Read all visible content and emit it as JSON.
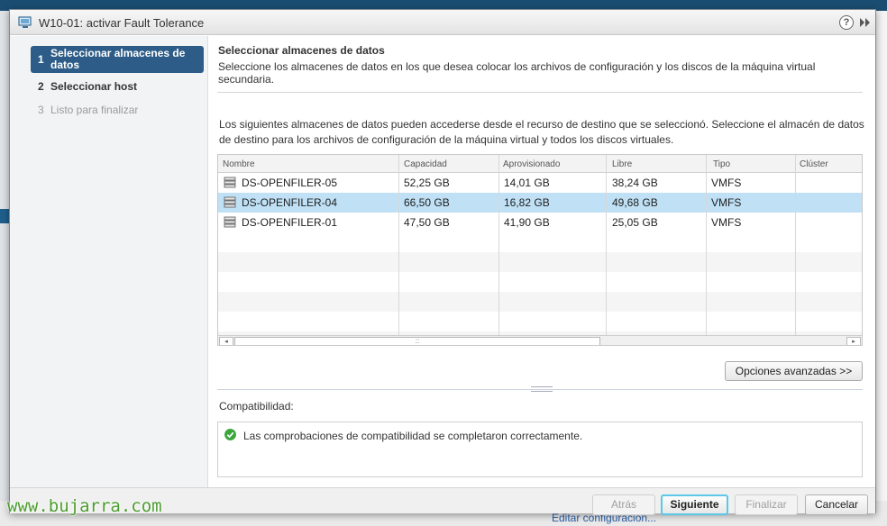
{
  "dialog": {
    "title": "W10-01: activar Fault Tolerance",
    "help_glyph": "?",
    "expand_glyph": "▸▸"
  },
  "steps": [
    {
      "num": "1",
      "label": "Seleccionar almacenes de datos",
      "state": "active"
    },
    {
      "num": "2",
      "label": "Seleccionar host",
      "state": "enabled"
    },
    {
      "num": "3",
      "label": "Listo para finalizar",
      "state": "disabled"
    }
  ],
  "main": {
    "title": "Seleccionar almacenes de datos",
    "subtitle": "Seleccione los almacenes de datos en los que desea colocar los archivos de configuración y los discos de la máquina virtual secundaria.",
    "description": "Los siguientes almacenes de datos pueden accederse desde el recurso de destino que se seleccionó. Seleccione el almacén de datos de destino para los archivos de configuración de la máquina virtual y todos los discos virtuales."
  },
  "table": {
    "columns": [
      "Nombre",
      "Capacidad",
      "Aprovisionado",
      "Libre",
      "Tipo",
      "Clúster"
    ],
    "rows": [
      {
        "name": "DS-OPENFILER-05",
        "capacity": "52,25 GB",
        "provisioned": "14,01 GB",
        "free": "38,24 GB",
        "type": "VMFS",
        "cluster": "",
        "selected": false
      },
      {
        "name": "DS-OPENFILER-04",
        "capacity": "66,50 GB",
        "provisioned": "16,82 GB",
        "free": "49,68 GB",
        "type": "VMFS",
        "cluster": "",
        "selected": true
      },
      {
        "name": "DS-OPENFILER-01",
        "capacity": "47,50 GB",
        "provisioned": "41,90 GB",
        "free": "25,05 GB",
        "type": "VMFS",
        "cluster": "",
        "selected": false
      }
    ],
    "row_icon": "datastore-icon",
    "scroll_left": "◂",
    "scroll_right": "▸",
    "scroll_grip": "::"
  },
  "advanced_button": "Opciones avanzadas >>",
  "compatibility": {
    "label": "Compatibilidad:",
    "message": "Las comprobaciones de compatibilidad se completaron correctamente.",
    "status_color": "#3aa63a"
  },
  "footer": {
    "back": "Atrás",
    "next": "Siguiente",
    "finish": "Finalizar",
    "cancel": "Cancelar"
  },
  "background": {
    "link": "Editar configuración..."
  },
  "watermark": "www.bujarra.com",
  "colors": {
    "active_step": "#2c5c87",
    "selected_row": "#bfe0f5",
    "primary_focus": "#5ac8e6"
  }
}
